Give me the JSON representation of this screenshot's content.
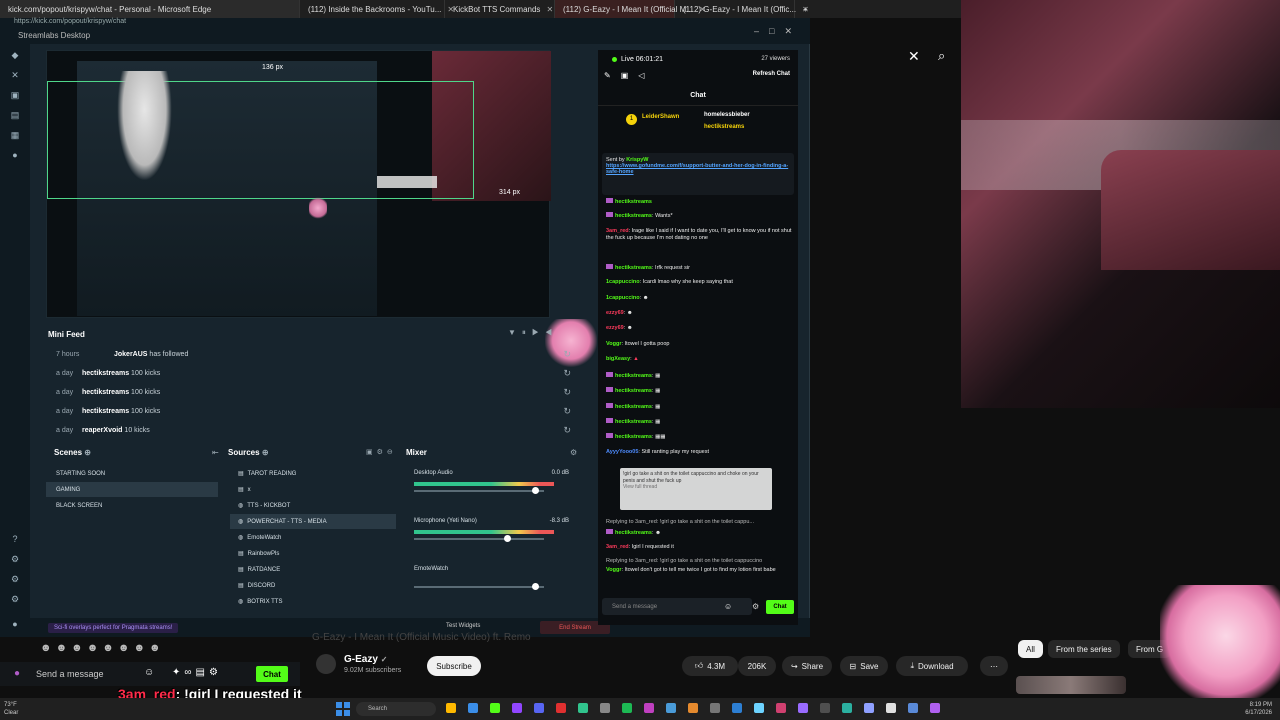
{
  "browser": {
    "tabs": [
      {
        "label": "kick.com/popout/krispyw/chat - Personal - Microsoft Edge"
      },
      {
        "label": "(112) Inside the Backrooms - YouTu..."
      },
      {
        "label": "KickBot TTS Commands"
      },
      {
        "label": "(112) G-Eazy - I Mean It (Official M..."
      },
      {
        "label": "(112) G-Eazy - I Mean It (Offic..."
      }
    ],
    "url": "https://kick.com/popout/krispyw/chat"
  },
  "streamlabs": {
    "title": "Streamlabs Desktop",
    "preview": {
      "dim_top": "136 px",
      "dim_right": "314 px"
    },
    "minifeed": {
      "title": "Mini Feed",
      "rows": [
        {
          "time": "7 hours",
          "name": "JokerAUS",
          "action": "has followed"
        },
        {
          "time": "a day",
          "name": "hectikstreams",
          "action": "100 kicks"
        },
        {
          "time": "a day",
          "name": "hectikstreams",
          "action": "100 kicks"
        },
        {
          "time": "a day",
          "name": "hectikstreams",
          "action": "100 kicks"
        },
        {
          "time": "a day",
          "name": "reaperXvoid",
          "action": "10 kicks"
        }
      ]
    },
    "scenes": {
      "title": "Scenes",
      "items": [
        "STARTING SOON",
        "GAMING",
        "BLACK SCREEN"
      ]
    },
    "sources": {
      "title": "Sources",
      "items": [
        "TAROT READING",
        "x",
        "TTS - KICKBOT",
        "POWERCHAT - TTS - MEDIA",
        "EmoteWatch",
        "RainbowPls",
        "RATDANCE",
        "DISCORD",
        "BOTRIX TTS"
      ]
    },
    "mixer": {
      "title": "Mixer",
      "channels": [
        {
          "name": "Desktop Audio",
          "db": "0.0 dB"
        },
        {
          "name": "Microphone (Yeti Nano)",
          "db": "-8.3 dB"
        },
        {
          "name": "EmoteWatch",
          "db": "0.0 dB"
        }
      ]
    },
    "footer": {
      "tip": "Sci-fi overlays perfect for Pragmata streams!",
      "test_widgets": "Test Widgets",
      "end_stream": "End Stream"
    }
  },
  "chat": {
    "live": "Live 06:01:21",
    "viewers": "27 viewers",
    "refresh": "Refresh Chat",
    "header": "Chat",
    "top": {
      "first": "LeiderShawn",
      "second": "homelessbieber",
      "third": "hectikstreams"
    },
    "pinned": {
      "sent_by": "Sent by",
      "sender": "KrispyW",
      "link": "https://www.gofundme.com/f/support-butter-and-her-dog-in-finding-a-safe-home"
    },
    "messages": [
      {
        "user": "hectikstreams",
        "text": ""
      },
      {
        "user": "hectikstreams",
        "text": "Wants*"
      },
      {
        "user": "3am_red",
        "text": ": Irage like I said if I want to date you, I'll get to know you if not shut the fuck up because I'm not dating no one"
      },
      {
        "user": "hectikstreams",
        "text": ": Irfk request sir"
      },
      {
        "user": "1cappuccino",
        "text": ": Icardi lmao why she keep saying that"
      },
      {
        "user": "1cappuccino",
        "text": ""
      },
      {
        "user": "ezzy69",
        "text": ""
      },
      {
        "user": "ezzy69",
        "text": ""
      },
      {
        "user": "Voggr",
        "text": ": Itowel I gotta poop"
      },
      {
        "user": "bigXeasy",
        "text": ""
      },
      {
        "user": "hectikstreams",
        "text": ""
      },
      {
        "user": "hectikstreams",
        "text": ""
      },
      {
        "user": "hectikstreams",
        "text": ""
      },
      {
        "user": "hectikstreams",
        "text": ""
      },
      {
        "user": "hectikstreams",
        "text": ""
      },
      {
        "user": "AyyyYooo05",
        "text": ": Still ranting play my request"
      },
      {
        "user": "hectikstreams",
        "text": ""
      },
      {
        "user": "3am_red",
        "text": ": Igirl I requested it"
      },
      {
        "user": "Voggr",
        "text": ": Itowel don't got to tell me twice I got to find my lotion first babe"
      }
    ],
    "reply_1": "Replying to 3am_red: !girl go take a shit on the toilet cappu...",
    "reply_2": "Replying to 3am_red: !girl go take a shit on the toilet cappuccino",
    "tooltip": "!girl go take a shit on the toilet cappuccino and choke on your penis and shut the fuck up",
    "tooltip_link": "View full thread",
    "input_placeholder": "Send a message",
    "send": "Chat"
  },
  "youtube": {
    "title": "G-Eazy - I Mean It (Official Music Video) ft. Remo",
    "channel": "G-Eazy",
    "subscribers": "9.02M subscribers",
    "subscribe": "Subscribe",
    "likes": "4.3M",
    "dislikes": "206K",
    "share": "Share",
    "save": "Save",
    "download": "Download",
    "chips": [
      "All",
      "From the series",
      "From G"
    ]
  },
  "kick_input": {
    "placeholder": "Send a message",
    "send": "Chat"
  },
  "tts_overlay": {
    "name": "3am_red",
    "text": ": !girl I requested it"
  },
  "taskbar": {
    "weather": "73°F",
    "weather2": "Clear",
    "search": "Search",
    "time": "8:19 PM",
    "date": "6/17/2026"
  }
}
